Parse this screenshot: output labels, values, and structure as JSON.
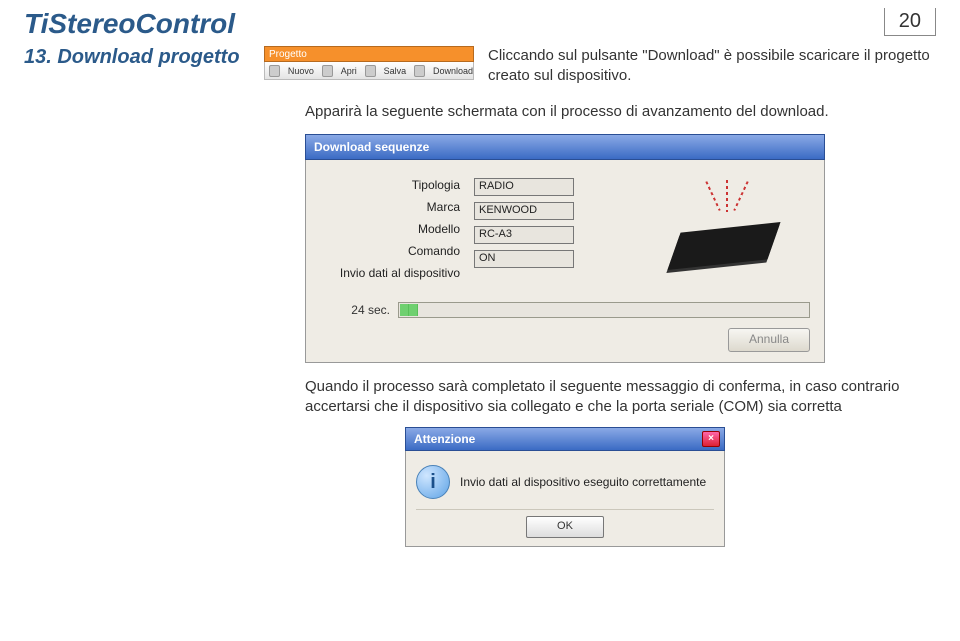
{
  "header": {
    "title": "TiStereoControl",
    "page_number": "20"
  },
  "section": {
    "heading": "13. Download progetto"
  },
  "toolbar": {
    "tab": "Progetto",
    "items": [
      "Nuovo",
      "Apri",
      "Salva",
      "Download"
    ]
  },
  "text": {
    "desc1": "Cliccando sul pulsante \"Download\" è possibile scaricare il progetto creato sul dispositivo.",
    "desc2": "Apparirà la seguente schermata con il processo di avanzamento del download.",
    "desc3": "Quando il processo sarà completato il seguente messaggio di conferma, in caso contrario accertarsi che il dispositivo sia collegato e che la porta seriale (COM) sia corretta"
  },
  "download_dialog": {
    "title": "Download sequenze",
    "labels": {
      "tipologia": "Tipologia",
      "marca": "Marca",
      "modello": "Modello",
      "comando": "Comando",
      "invio": "Invio dati al dispositivo"
    },
    "values": {
      "tipologia": "RADIO",
      "marca": "KENWOOD",
      "modello": "RC-A3",
      "comando": "ON"
    },
    "seconds": "24 sec.",
    "cancel_label": "Annulla"
  },
  "alert_dialog": {
    "title": "Attenzione",
    "icon_char": "i",
    "message": "Invio dati al dispositivo eseguito correttamente",
    "ok_label": "OK"
  }
}
